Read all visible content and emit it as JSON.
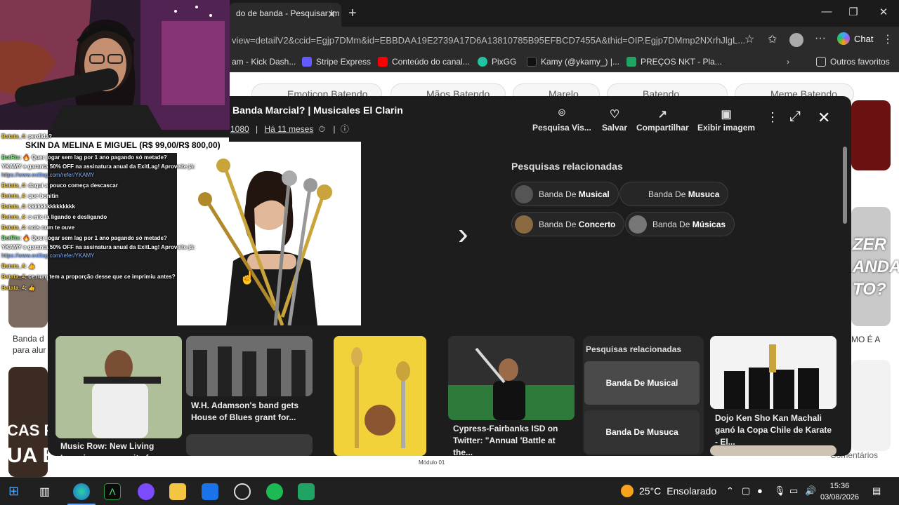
{
  "browser": {
    "tab_title": "do de banda - Pesquisar Im",
    "url": "view=detailV2&ccid=Egjp7DMm&id=EBBDAA19E2739A17D6A13810785B95EFBCD7455A&thid=OIP.Egjp7DMmp2NXrhJlgL...",
    "chat_label": "Chat",
    "bookmarks": [
      "am - Kick Dash...",
      "Stripe Express",
      "Conteúdo do canal...",
      "PixGG",
      "Kamy (@ykamy_) |...",
      "PREÇOS NKT - Pla...",
      "Outros favoritos"
    ]
  },
  "background_page": {
    "chips": [
      "Emoticon Batendo",
      "Mãos Batendo",
      "Marelo",
      "Batendo",
      "Meme Batendo"
    ],
    "left_caption_1": "Banda d",
    "left_caption_2": "para alur",
    "right_caption": "MO É A",
    "footer_label": "Comentários",
    "module_label": "Módulo 01",
    "promo_left_1": "CAS PA",
    "promo_left_2": "UA BANDA",
    "promo_right": "ZER ANDA TO?"
  },
  "overlay": {
    "title": "Banda Marcial? | Musicales El Clarin",
    "resolution": "1080",
    "time_ago": "Há 11 meses",
    "actions": [
      {
        "label": "Pesquisa Vis...",
        "icon": "visual-search-icon"
      },
      {
        "label": "Salvar",
        "icon": "save-icon"
      },
      {
        "label": "Compartilhar",
        "icon": "share-icon"
      },
      {
        "label": "Exibir imagem",
        "icon": "image-icon"
      }
    ],
    "related_title": "Pesquisas relacionadas",
    "related_chips": [
      {
        "prefix": "Banda De ",
        "bold": "Musical"
      },
      {
        "prefix": "Banda De ",
        "bold": "Musuca"
      },
      {
        "prefix": "Banda De ",
        "bold": "Concerto"
      },
      {
        "prefix": "Banda De ",
        "bold": "Músicas"
      }
    ],
    "grid": [
      {
        "caption": "Music Row: New Living Learning community for music lovers |"
      },
      {
        "caption": "W.H. Adamson's band gets House of Blues grant for..."
      },
      {
        "caption": ""
      },
      {
        "caption": "Cypress-Fairbanks ISD on Twitter: \"Annual 'Battle at the..."
      },
      {
        "caption": "Dojo Ken Sho Kan Machali ganó la Copa Chile de Karate - El..."
      }
    ],
    "related2_title": "Pesquisas relacionadas",
    "related2_items": [
      "Banda De Musical",
      "Banda De Musuca"
    ]
  },
  "stream": {
    "banner": "SKIN DA MELINA E MIGUEL (R$ 99,00/R$ 800,00)",
    "messages": [
      {
        "user": "Batata_4",
        "text": ": perdida?"
      },
      {
        "user": "BotRix",
        "text": ": 🔥 Quer jogar sem lag por 1 ano pagando só metade?",
        "bot": true
      },
      {
        "user": "",
        "text": "YKAMY e garanta 50% OFF na assinatura anual da ExitLag! Aproveite já:"
      },
      {
        "user": "",
        "text": "https://www.exitlag.com/refer/YKAMY",
        "link": true
      },
      {
        "user": "Batata_4",
        "text": ": daqui a pouco começa descascar"
      },
      {
        "user": "Batata_4",
        "text": ": que bonitin"
      },
      {
        "user": "Batata_4",
        "text": ": kkkkkkkkkkkkkkk"
      },
      {
        "user": "Batata_4",
        "text": ": o mic ta ligando e desligando"
      },
      {
        "user": "Batata_4",
        "text": ": nois num te ouve"
      },
      {
        "user": "BotRix",
        "text": ": 🔥 Quer jogar sem lag por 1 ano pagando só metade?",
        "bot": true
      },
      {
        "user": "",
        "text": "YKAMY e garanta 50% OFF na assinatura anual da ExitLag! Aproveite já:"
      },
      {
        "user": "",
        "text": "https://www.exitlag.com/refer/YKAMY",
        "link": true
      },
      {
        "user": "Batata_4",
        "text": ": 👍"
      },
      {
        "user": "Batata_4",
        "text": ": ce num tem a proporção desse que ce imprimiu antes?"
      },
      {
        "user": "Batata_4",
        "text": ": 👍"
      }
    ]
  },
  "taskbar": {
    "temperature": "25°C",
    "weather": "Ensolarado",
    "time": "15:36",
    "date": "03/08/2026"
  }
}
